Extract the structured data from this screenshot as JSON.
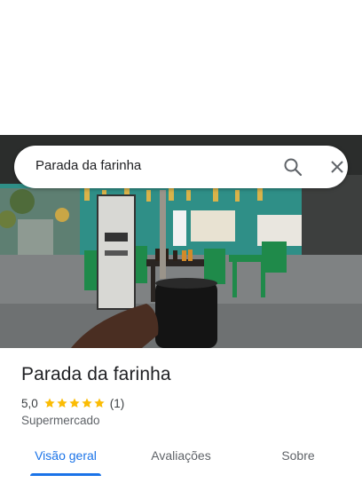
{
  "search": {
    "query": "Parada da farinha",
    "search_icon": "search-icon",
    "close_icon": "close-icon"
  },
  "place": {
    "name": "Parada da farinha",
    "rating": "5,0",
    "stars": 5,
    "review_count": "(1)",
    "category": "Supermercado"
  },
  "tabs": [
    {
      "label": "Visão geral",
      "active": true
    },
    {
      "label": "Avaliações",
      "active": false
    },
    {
      "label": "Sobre",
      "active": false
    }
  ],
  "colors": {
    "accent": "#1a73e8",
    "star": "#fbbc04"
  }
}
